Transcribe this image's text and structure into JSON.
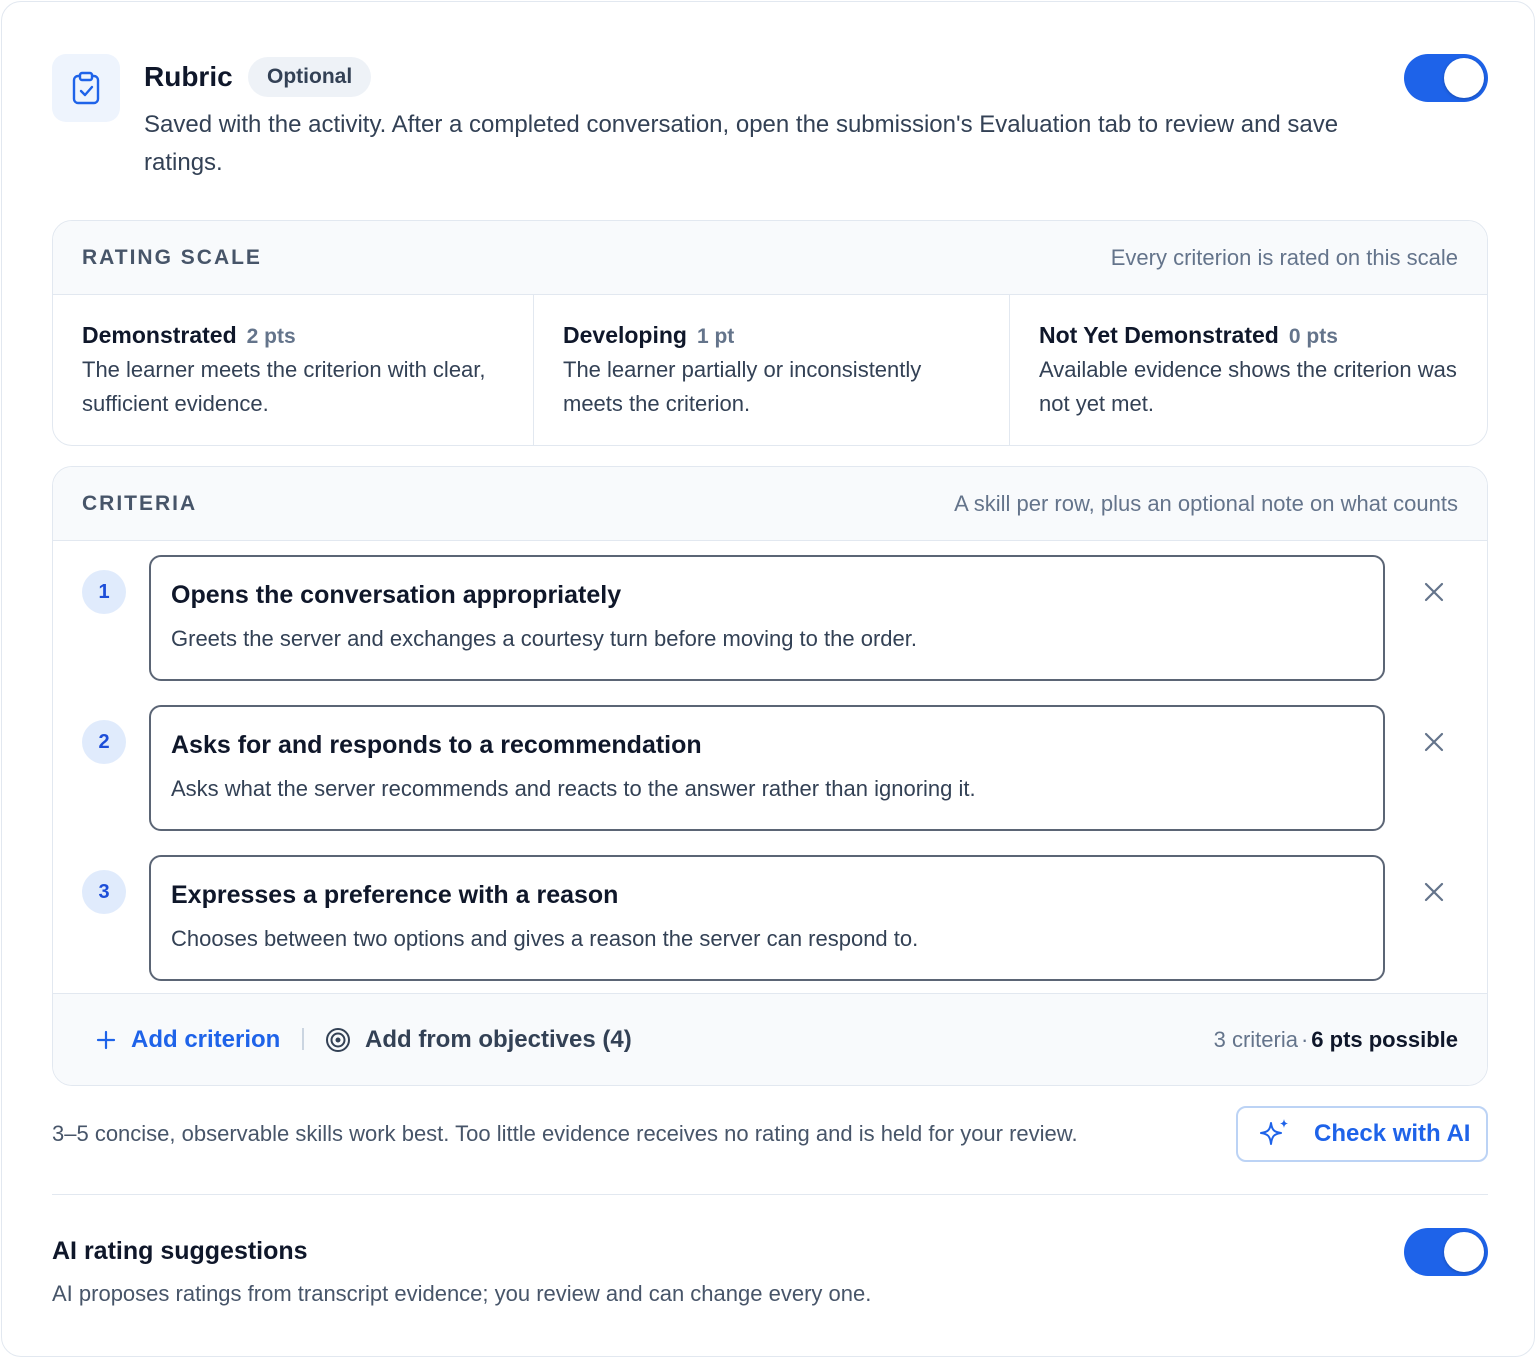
{
  "header": {
    "title": "Rubric",
    "badge": "Optional",
    "description": "Saved with the activity. After a completed conversation, open the submission's Evaluation tab to review and save ratings.",
    "icon": "clipboard-check-icon",
    "enabled": true
  },
  "rating_scale": {
    "label": "RATING SCALE",
    "note": "Every criterion is rated on this scale",
    "levels": [
      {
        "name": "Demonstrated",
        "points": "2 pts",
        "description": "The learner meets the criterion with clear, sufficient evidence."
      },
      {
        "name": "Developing",
        "points": "1 pt",
        "description": "The learner partially or inconsistently meets the criterion."
      },
      {
        "name": "Not Yet Demonstrated",
        "points": "0 pts",
        "description": "Available evidence shows the criterion was not yet met."
      }
    ]
  },
  "criteria": {
    "label": "CRITERIA",
    "note": "A skill per row, plus an optional note on what counts",
    "items": [
      {
        "number": "1",
        "title": "Opens the conversation appropriately",
        "note": "Greets the server and exchanges a courtesy turn before moving to the order."
      },
      {
        "number": "2",
        "title": "Asks for and responds to a recommendation",
        "note": "Asks what the server recommends and reacts to the answer rather than ignoring it."
      },
      {
        "number": "3",
        "title": "Expresses a preference with a reason",
        "note": "Chooses between two options and gives a reason the server can respond to."
      }
    ],
    "add_label": "Add criterion",
    "add_from_objectives_label": "Add from objectives (4)",
    "count_text": "3 criteria",
    "separator": "·",
    "points_text": "6 pts possible"
  },
  "hint": "3–5 concise, observable skills work best. Too little evidence receives no rating and is held for your review.",
  "check_ai_label": "Check with AI",
  "ai_suggestions": {
    "title": "AI rating suggestions",
    "description": "AI proposes ratings from transcript evidence; you review and can change every one.",
    "enabled": true
  },
  "colors": {
    "accent": "#1e63e9",
    "toggle_on": "#1e63e9",
    "border": "#e2e8f0"
  }
}
